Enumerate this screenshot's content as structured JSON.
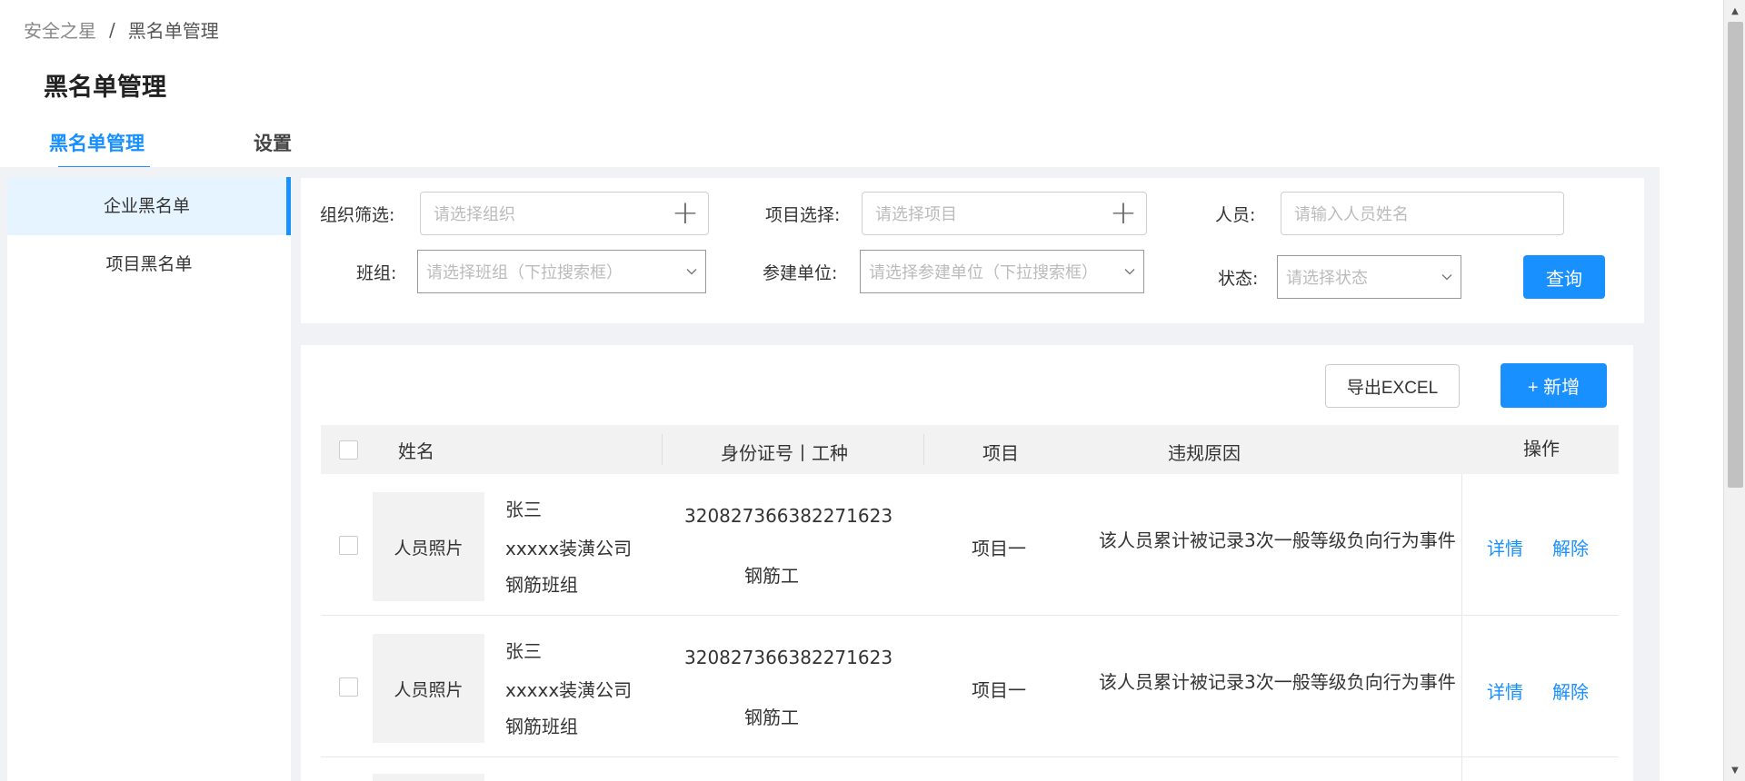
{
  "breadcrumb": {
    "root": "安全之星",
    "separator": "/",
    "current": "黑名单管理"
  },
  "page_title": "黑名单管理",
  "tabs": [
    {
      "label": "黑名单管理",
      "active": true
    },
    {
      "label": "设置",
      "active": false
    }
  ],
  "side_menu": [
    {
      "label": "企业黑名单",
      "active": true
    },
    {
      "label": "项目黑名单",
      "active": false
    }
  ],
  "filters": {
    "org_label": "组织筛选:",
    "org_placeholder": "请选择组织",
    "project_label": "项目选择:",
    "project_placeholder": "请选择项目",
    "person_label": "人员:",
    "person_placeholder": "请输入人员姓名",
    "team_label": "班组:",
    "team_placeholder": "请选择班组（下拉搜索框）",
    "unit_label": "参建单位:",
    "unit_placeholder": "请选择参建单位（下拉搜索框）",
    "status_label": "状态:",
    "status_placeholder": "请选择状态",
    "query_label": "查询"
  },
  "actions": {
    "export_label": "导出EXCEL",
    "add_label": "+  新增"
  },
  "table": {
    "headers": {
      "name": "姓名",
      "id_trade": "身份证号丨工种",
      "project": "项目",
      "reason": "违规原因",
      "ops": "操作"
    },
    "rows": [
      {
        "photo": "人员照片",
        "name": "张三",
        "company": "xxxxx装潢公司",
        "team": "钢筋班组",
        "id_number": "320827366382271623",
        "trade": "钢筋工",
        "project": "项目一",
        "reason": "该人员累计被记录3次一般等级负向行为事件",
        "detail": "详情",
        "remove": "解除"
      },
      {
        "photo": "人员照片",
        "name": "张三",
        "company": "xxxxx装潢公司",
        "team": "钢筋班组",
        "id_number": "320827366382271623",
        "trade": "钢筋工",
        "project": "项目一",
        "reason": "该人员累计被记录3次一般等级负向行为事件",
        "detail": "详情",
        "remove": "解除"
      }
    ]
  },
  "colors": {
    "primary": "#1890ff",
    "active_bg": "#e6f4ff",
    "body_bg": "#f0f2f5"
  }
}
